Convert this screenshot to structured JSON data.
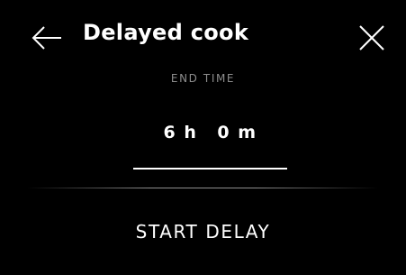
{
  "header": {
    "title": "Delayed cook",
    "back_icon": "arrow-left-icon",
    "close_icon": "close-icon"
  },
  "end_time": {
    "label": "END TIME",
    "hours": "6 h",
    "minutes": "0 m"
  },
  "actions": {
    "start_label": "START DELAY"
  },
  "colors": {
    "background": "#000000",
    "text": "#ffffff",
    "muted_text": "#8c8c8c"
  }
}
